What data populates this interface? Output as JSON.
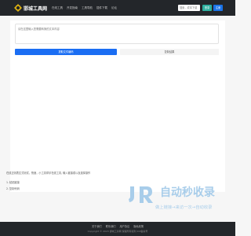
{
  "nav": {
    "logo_text": "邯城工具网",
    "links": [
      "在线工具",
      "开发指南",
      "工具导航",
      "插件下载",
      "论坛"
    ],
    "search_placeholder": "搜索，成本下载",
    "login": "登录",
    "register": "注册"
  },
  "main": {
    "input_placeholder": "请在这里输入您需要转换的文本内容",
    "primary_button": "提取文件编码",
    "secondary_button": "复制结果"
  },
  "help": {
    "note": "在线正则表达式测试，快速，小工具帮手在线工具, 输入链接或以及选择操作",
    "steps": [
      "1. 粘贴链接",
      "2. 复制代码"
    ]
  },
  "watermark": {
    "big": "自动秒收录",
    "small": "做上链接→来访一次→自动收录"
  },
  "footer": {
    "links": [
      "关于我们",
      "联系我们",
      "用户协议",
      "隐私政策"
    ],
    "copyright": "Copyright © 2023 邯城工具网 保留所有权利 ICP备案号"
  },
  "colors": {
    "nav_bg": "#23262a",
    "primary": "#1b6ef3",
    "login": "#2eaf9f",
    "register": "#1a73e8",
    "watermark": "#a8cdea"
  }
}
